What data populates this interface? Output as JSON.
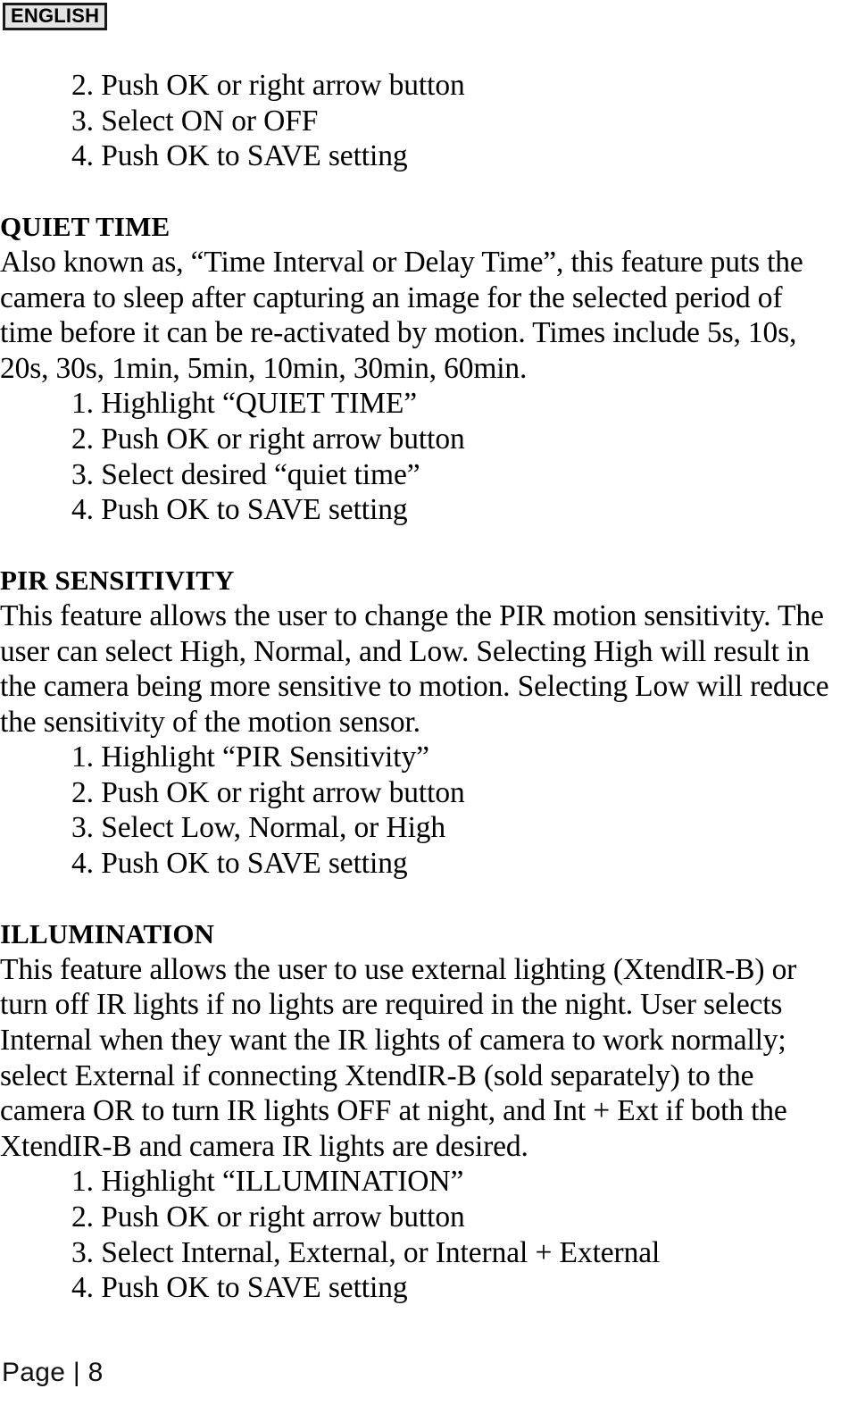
{
  "header": {
    "language_badge": "ENGLISH"
  },
  "content": {
    "top_steps": [
      "2. Push OK or right arrow button",
      "3. Select ON or OFF",
      "4. Push OK to SAVE setting"
    ],
    "sections": [
      {
        "heading": "QUIET TIME",
        "body_lines": [
          "Also known as, “Time Interval or Delay Time”, this feature puts the",
          "camera to sleep after capturing an image for the selected period of",
          "time before it can be re-activated by motion. Times include 5s, 10s,",
          "20s, 30s, 1min, 5min, 10min, 30min, 60min."
        ],
        "steps": [
          "1. Highlight “QUIET TIME”",
          "2. Push OK or right arrow button",
          "3. Select desired “quiet time”",
          "4. Push OK to SAVE setting"
        ]
      },
      {
        "heading": "PIR SENSITIVITY",
        "body_lines": [
          "This feature allows the user to change the PIR motion sensitivity. The",
          "user can select High, Normal, and Low. Selecting High will result in",
          "the camera being more sensitive to motion. Selecting Low will reduce",
          "the sensitivity of the motion sensor."
        ],
        "steps": [
          "1. Highlight “PIR Sensitivity”",
          "2. Push OK or right arrow button",
          "3. Select Low, Normal, or High",
          "4. Push OK to SAVE setting"
        ]
      },
      {
        "heading": "ILLUMINATION",
        "body_lines": [
          "This feature allows the user to use external lighting (XtendIR-B) or",
          "turn off IR lights if no lights are required in the night. User selects",
          "Internal when they want the IR lights of camera to work normally;",
          "select External if connecting XtendIR-B (sold separately) to the",
          "camera OR to turn IR lights OFF at night, and Int + Ext if both the",
          "XtendIR-B and camera IR lights are desired."
        ],
        "steps": [
          "1. Highlight “ILLUMINATION”",
          "2. Push OK or right arrow button",
          "3. Select Internal, External, or Internal + External",
          "4. Push OK to SAVE setting"
        ]
      }
    ]
  },
  "footer": {
    "page_label": "Page | 8"
  },
  "colors": {
    "text": "#000000",
    "badge_background": "#e3e3e3",
    "badge_border": "#1a1a1a",
    "page_background": "#ffffff"
  }
}
